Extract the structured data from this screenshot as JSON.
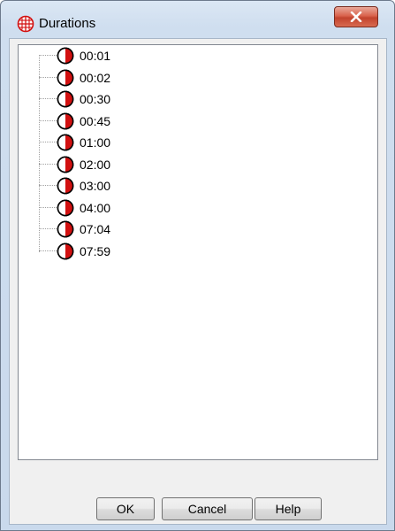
{
  "window": {
    "title": "Durations",
    "title_icon": "red-grid-globe-icon",
    "close_icon": "close-x-icon"
  },
  "tree": {
    "item_icon": "pie-clock-icon",
    "items": [
      {
        "label": "00:01"
      },
      {
        "label": "00:02"
      },
      {
        "label": "00:30"
      },
      {
        "label": "00:45"
      },
      {
        "label": "01:00"
      },
      {
        "label": "02:00"
      },
      {
        "label": "03:00"
      },
      {
        "label": "04:00"
      },
      {
        "label": "07:04"
      },
      {
        "label": "07:59"
      }
    ]
  },
  "buttons": {
    "ok_label": "OK",
    "cancel_label": "Cancel",
    "help_label": "Help"
  },
  "colors": {
    "accent_red": "#d21010",
    "titlebar": "#d5e3f3",
    "close_button": "#c9482f"
  }
}
